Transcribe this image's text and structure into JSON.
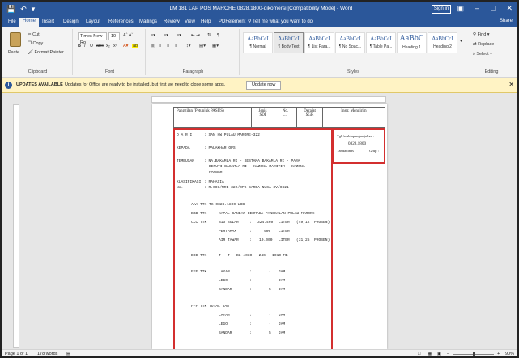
{
  "titlebar": {
    "title": "TLM 181 LAP POS MARORE 0828.1800-dikomersi [Compatibility Mode] - Word",
    "signin": "Sign in",
    "save_icon": "save-icon",
    "undo_icon": "undo-icon"
  },
  "tabs": [
    "File",
    "Home",
    "Insert",
    "Design",
    "Layout",
    "References",
    "Mailings",
    "Review",
    "View",
    "Help",
    "PDFelement"
  ],
  "tell_me": "Tell me what you want to do",
  "share": "Share",
  "ribbon": {
    "clipboard": {
      "paste": "Paste",
      "cut": "Cut",
      "copy": "Copy",
      "format_painter": "Format Painter",
      "label": "Clipboard"
    },
    "font": {
      "name": "Times New Ro",
      "size": "10",
      "label": "Font",
      "b": "B",
      "i": "I",
      "u": "U",
      "strike": "abc",
      "sub": "x₂",
      "sup": "x²"
    },
    "paragraph": {
      "label": "Paragraph"
    },
    "styles": {
      "label": "Styles",
      "items": [
        {
          "sample": "AaBbCcI",
          "name": "¶ Normal"
        },
        {
          "sample": "AaBbCcI",
          "name": "¶ Body Text"
        },
        {
          "sample": "AaBbCcI",
          "name": "¶ List Para..."
        },
        {
          "sample": "AaBbCcI",
          "name": "¶ No Spac..."
        },
        {
          "sample": "AaBbCcI",
          "name": "¶ Table Pa..."
        },
        {
          "sample": "AaBbC",
          "name": "Heading 1"
        },
        {
          "sample": "AaBbCcI",
          "name": "Heading 2"
        }
      ]
    },
    "editing": {
      "find": "Find",
      "replace": "Replace",
      "select": "Select",
      "label": "Editing"
    }
  },
  "update_bar": {
    "title": "UPDATES AVAILABLE",
    "message": "Updates for Office are ready to be installed, but first we need to close some apps.",
    "button": "Update now"
  },
  "document": {
    "header": {
      "cell1": "Panggilan (Petunjuk PASUS)",
      "jenis": "Jenis",
      "sdi": "SDI",
      "no": "No.",
      "dots": "....",
      "derajat": "Derajat",
      "sgr": "SGR",
      "instr": "Instr. Mengirim",
      "tgl": "Tgl./waktupengunjukan :",
      "tgl_val": "0828.1800",
      "tanda": "Tandadinas",
      "grup": "Grup :"
    },
    "dari_label": "D A R I",
    "dari_val": ":  SAN HW PULAU MARORE-322",
    "kepada_label": "KEPADA",
    "kepada_val": ":  PALAKHAR OPS",
    "tembusan_label": "TEMBUSAN",
    "tembusan_l1": ":  NA.BAKAMLA RI - SESTAMA BAKAMLA RI - PARA",
    "tembusan_l2": "DEPUTI BAKAMLA RI - KAZONA MARITIM - KAZONA",
    "tembusan_l3": "HARBAR",
    "klasifikasi_label": "KLASIFIKASI",
    "klasifikasi_val": ":  RAHASIA",
    "no_label": "No.",
    "no_val": ":  R.001/MRE-322/OPS GARDA NUSA XV/0821",
    "aaa": "AAA TTK TK 0828.1800 WIB",
    "bbb_label": "BBB TTK",
    "bbb_val": "KAPAL SANDAR DERMAGA PANGKALAN PULAU MARORE",
    "ccc_label": "CCC TTK",
    "ccc_rows": [
      {
        "item": "BIO SOLAR",
        "colon": ":",
        "qty": "324.460",
        "unit": "LITER",
        "pct": "(49,12",
        "pctu": "PROSEN)"
      },
      {
        "item": "PERTAMAX",
        "colon": ":",
        "qty": "900",
        "unit": "LITER",
        "pct": "",
        "pctu": ""
      },
      {
        "item": "AIR TAWAR",
        "colon": ":",
        "qty": "10.000",
        "unit": "LITER",
        "pct": "(31,25",
        "pctu": "PROSEN)"
      }
    ],
    "ddd_label": "DDD TTK",
    "ddd_val": "T - T - BL /080 - 24C - 1010 MB",
    "eee_label": "EEE TTK",
    "eee_rows": [
      {
        "item": "LAYAR",
        "colon": ":",
        "qty": "-",
        "unit": "JAM"
      },
      {
        "item": "LEGO",
        "colon": ":",
        "qty": "-",
        "unit": "JAM"
      },
      {
        "item": "SANDAR",
        "colon": ":",
        "qty": "5",
        "unit": "JAM"
      }
    ],
    "fff_label": "FFF TTK TOTAL JAM",
    "fff_rows": [
      {
        "item": "LAYAR",
        "colon": ":",
        "qty": "-",
        "unit": "JAM"
      },
      {
        "item": "LEGO",
        "colon": ":",
        "qty": "-",
        "unit": "JAM"
      },
      {
        "item": "SANDAR",
        "colon": ":",
        "qty": "5",
        "unit": "JAM"
      }
    ]
  },
  "status": {
    "page": "Page 1 of 1",
    "words": "178 words",
    "zoom": "90%"
  }
}
